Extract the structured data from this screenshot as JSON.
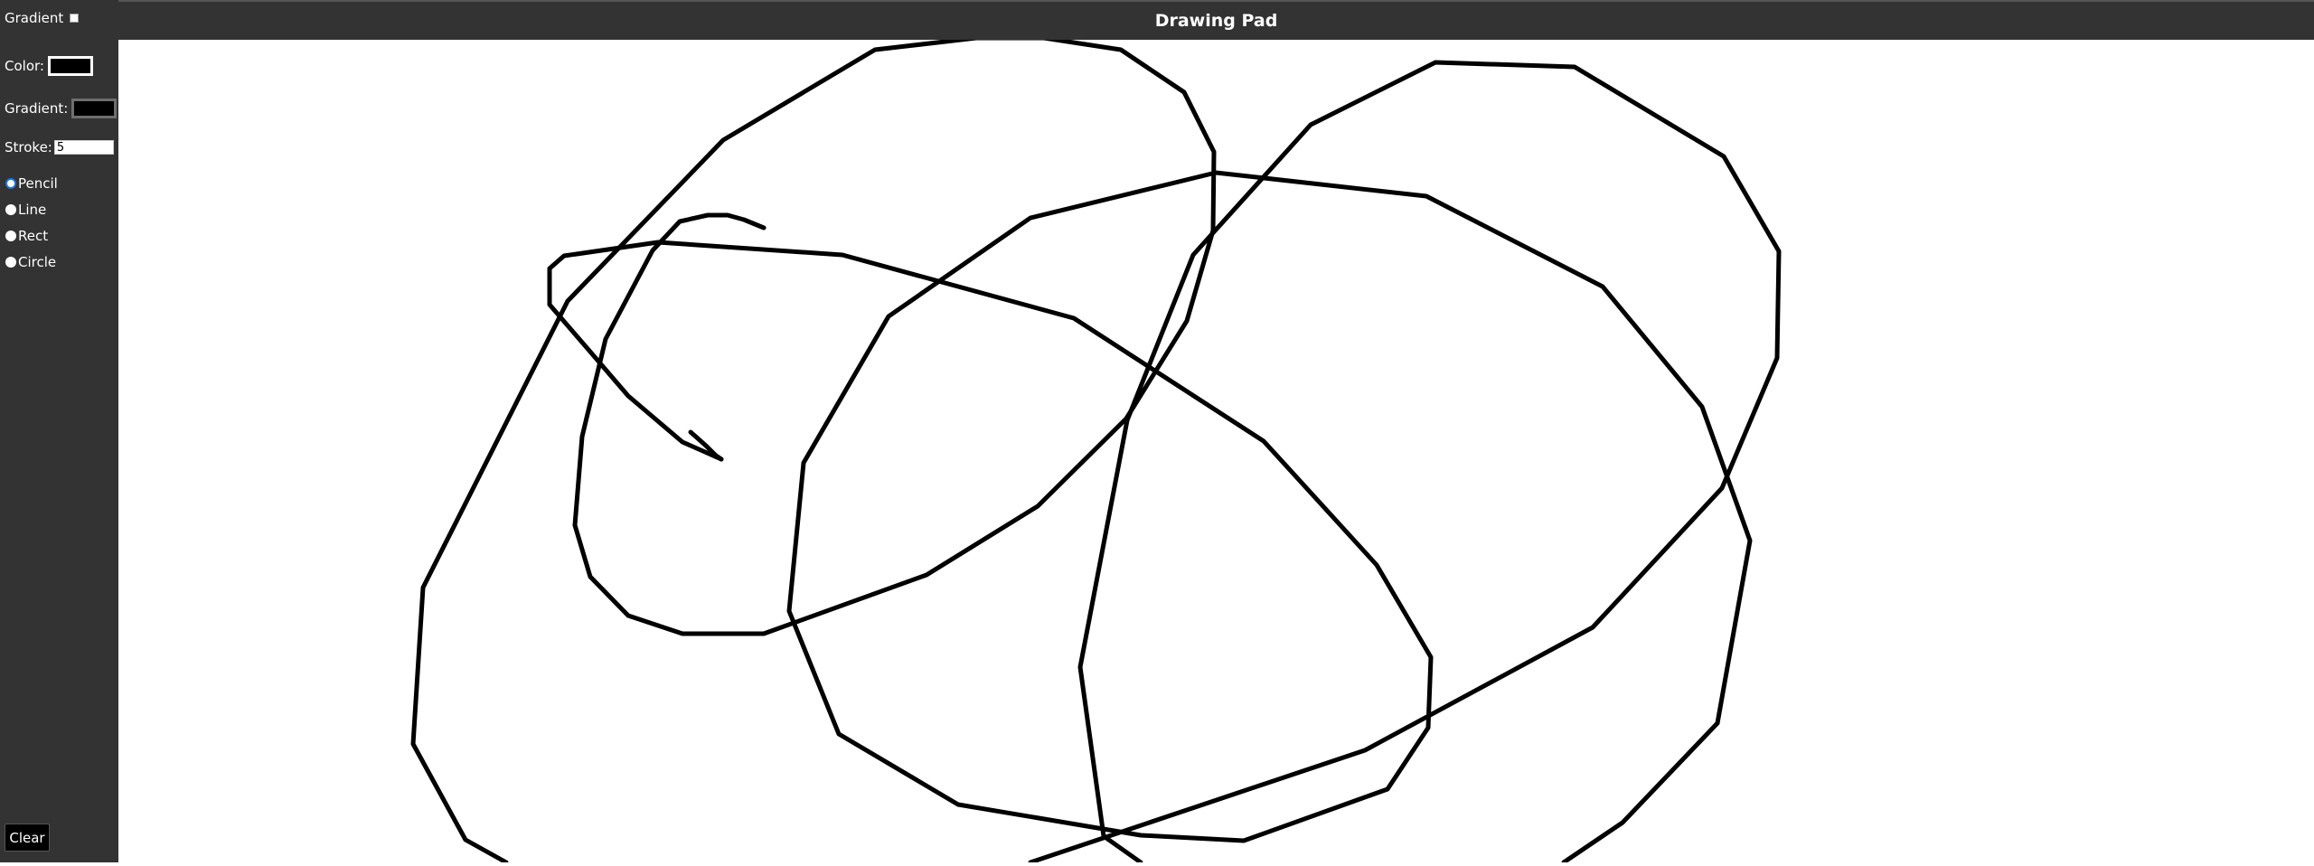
{
  "header": {
    "title": "Drawing Pad"
  },
  "sidebar": {
    "gradient_toggle_label": "Gradient",
    "gradient_toggle_checked": false,
    "color_label": "Color:",
    "color_value": "#000000",
    "gradient_label": "Gradient:",
    "gradient_value": "#000000",
    "stroke_label": "Stroke:",
    "stroke_value": "5",
    "tools": [
      {
        "label": "Pencil",
        "selected": true
      },
      {
        "label": "Line",
        "selected": false
      },
      {
        "label": "Rect",
        "selected": false
      },
      {
        "label": "Circle",
        "selected": false
      }
    ],
    "clear_label": "Clear"
  },
  "colors": {
    "sidebar_bg": "#333333",
    "canvas_bg": "#ffffff",
    "stroke": "#000000",
    "radio_selected": "#1a73e8"
  }
}
